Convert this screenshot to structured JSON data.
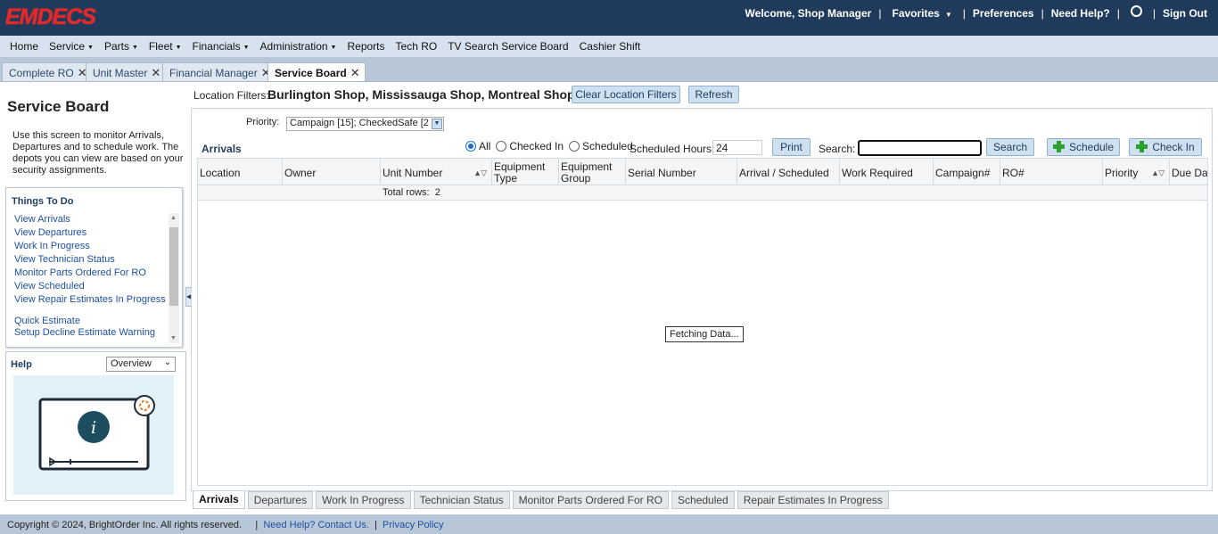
{
  "app": {
    "logo_text": "EMDECS",
    "brand_color": "#e02a2a",
    "header_color": "#1f3a5a"
  },
  "top": {
    "welcome": "Welcome, Shop Manager",
    "favorites": "Favorites",
    "preferences": "Preferences",
    "need_help": "Need Help?",
    "sign_out": "Sign Out"
  },
  "menu": [
    "Home",
    "Service",
    "Parts",
    "Fleet",
    "Financials",
    "Administration",
    "Reports",
    "Tech RO",
    "TV Search Service Board",
    "Cashier Shift"
  ],
  "menu_has_dropdown": [
    false,
    true,
    true,
    true,
    true,
    true,
    false,
    false,
    false,
    false
  ],
  "page_tabs": [
    {
      "label": "Complete RO",
      "active": false
    },
    {
      "label": "Unit Master",
      "active": false
    },
    {
      "label": "Financial Manager",
      "active": false
    },
    {
      "label": "Service Board",
      "active": true
    }
  ],
  "left": {
    "title": "Service Board",
    "description": "Use this screen to monitor Arrivals, Departures and to schedule work. The depots you can view are based on your security assignments.",
    "todo_title": "Things To Do",
    "todo_items": [
      "View Arrivals",
      "View Departures",
      "Work In Progress",
      "View Technician Status",
      "Monitor Parts Ordered For RO",
      "View Scheduled",
      "View Repair Estimates In Progress",
      "Quick Estimate",
      "Setup Decline Estimate Warning"
    ],
    "help_title": "Help",
    "help_select": "Overview"
  },
  "filters": {
    "label": "Location Filters:",
    "value": "Burlington Shop, Mississauga Shop, Montreal Shop",
    "clear_button": "Clear Location Filters",
    "refresh_button": "Refresh"
  },
  "priority": {
    "label": "Priority:",
    "value": "Campaign [15]; CheckedSafe [2"
  },
  "toolbar": {
    "section_title": "Arrivals",
    "radio_all": "All",
    "radio_checked_in": "Checked In",
    "radio_scheduled": "Scheduled",
    "radio_selected": "All",
    "sched_hours_label": "Scheduled Hours:",
    "sched_hours_value": "24",
    "print_button": "Print",
    "search_label": "Search:",
    "search_value": "",
    "search_button": "Search",
    "schedule_button": "Schedule",
    "checkin_button": "Check In"
  },
  "grid": {
    "columns": [
      "Location",
      "Owner",
      "Unit Number",
      "Equipment Type",
      "Equipment Group",
      "Serial Number",
      "Arrival / Scheduled",
      "Work Required",
      "Campaign#",
      "RO#",
      "Priority",
      "Due Dat"
    ],
    "total_rows_label": "Total rows:",
    "total_rows": "2",
    "loading_text": "Fetching Data..."
  },
  "bottom_tabs": [
    {
      "label": "Arrivals",
      "active": true
    },
    {
      "label": "Departures",
      "active": false
    },
    {
      "label": "Work In Progress",
      "active": false
    },
    {
      "label": "Technician Status",
      "active": false
    },
    {
      "label": "Monitor Parts Ordered For RO",
      "active": false
    },
    {
      "label": "Scheduled",
      "active": false
    },
    {
      "label": "Repair Estimates In Progress",
      "active": false
    }
  ],
  "footer": {
    "copyright": "Copyright © 2024, BrightOrder Inc. All rights reserved.",
    "help_link": "Need Help? Contact Us.",
    "privacy_link": "Privacy Policy"
  }
}
